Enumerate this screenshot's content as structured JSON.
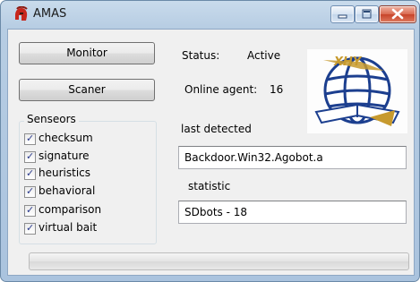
{
  "window": {
    "title": "AMAS",
    "icon": "spartan-helmet-icon",
    "caption_buttons": [
      "minimize-icon",
      "maximize-icon",
      "close-icon"
    ]
  },
  "buttons": {
    "monitor": "Monitor",
    "scaner": "Scaner"
  },
  "status": {
    "label": "Status:",
    "value": "Active"
  },
  "online_agent": {
    "label": "Online agent:",
    "value": "16"
  },
  "sensors": {
    "title": "Senseors",
    "items": [
      {
        "label": "checksum",
        "checked": true
      },
      {
        "label": "signature",
        "checked": true
      },
      {
        "label": "heuristics",
        "checked": true
      },
      {
        "label": "behavioral",
        "checked": true
      },
      {
        "label": "comparison",
        "checked": true
      },
      {
        "label": "virtual bait",
        "checked": true
      }
    ]
  },
  "last_detected": {
    "label": "last detected",
    "value": "Backdoor.Win32.Agobot.a"
  },
  "statistic": {
    "label": "statistic",
    "value": "SDbots - 18"
  },
  "logo": {
    "text": "XHY"
  },
  "progress": {
    "value": 0
  },
  "colors": {
    "titlebar": "#b7cde3",
    "close_button": "#c7442a",
    "client_bg": "#f0f0f0",
    "logo_blue": "#1c3f8f",
    "logo_gold": "#c79a2e"
  }
}
